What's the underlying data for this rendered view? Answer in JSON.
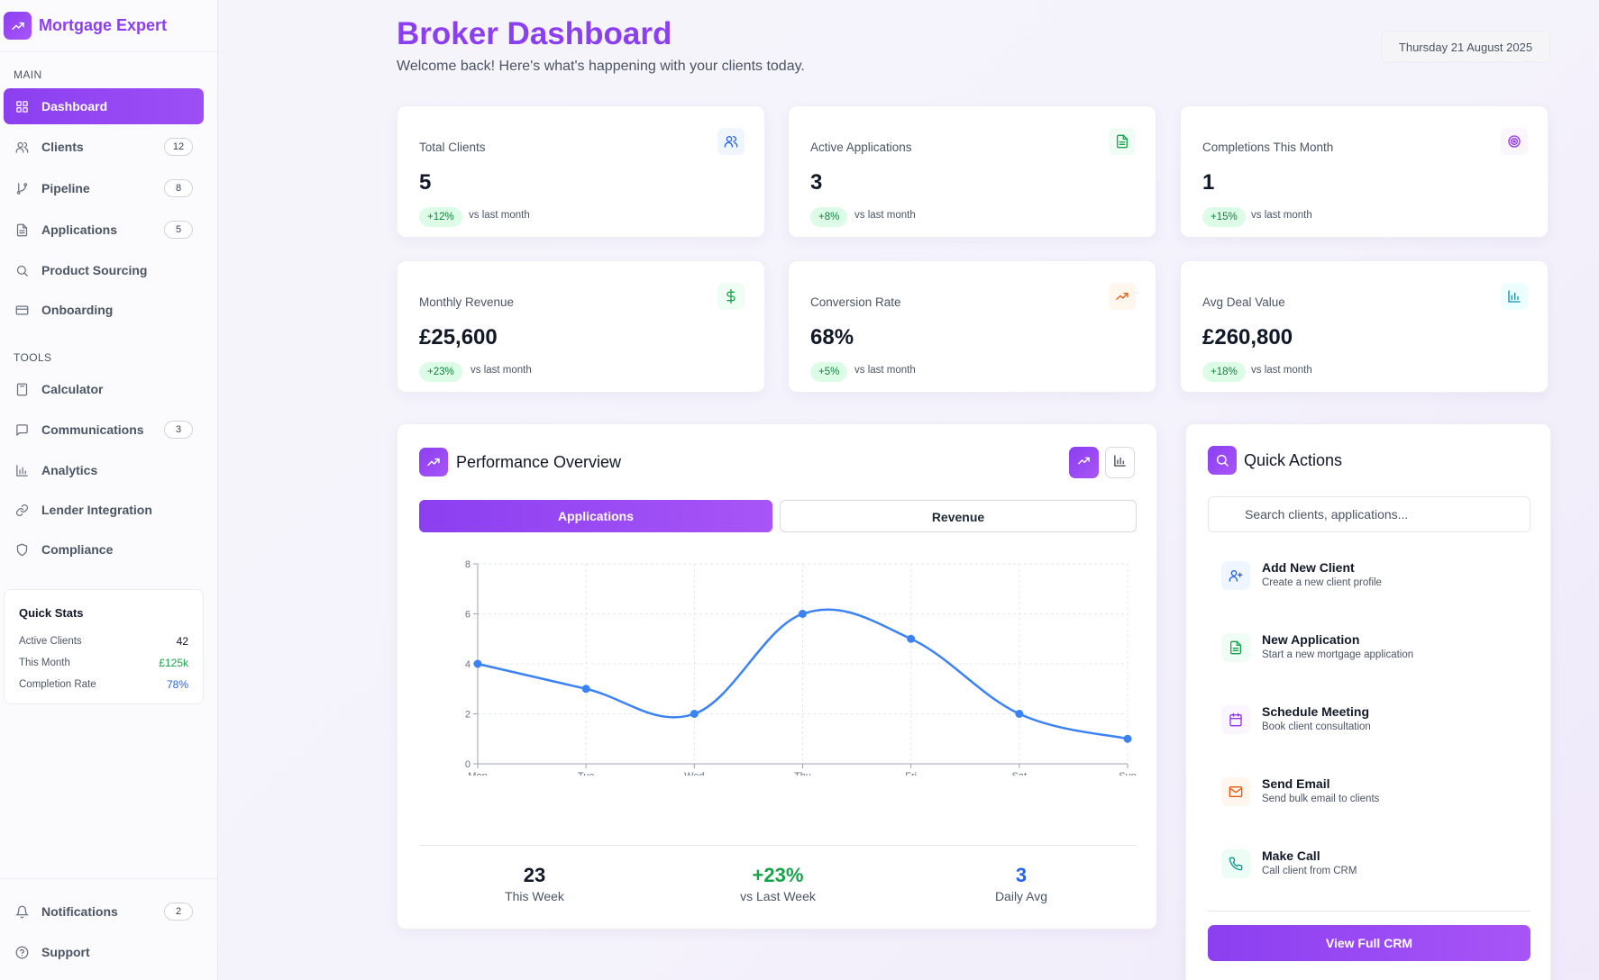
{
  "brand": {
    "name": "Mortgage Expert"
  },
  "colors": {
    "accent": "#8b3ff0",
    "accent_light": "#a855f7",
    "green": "#16a34a",
    "blue": "#2563eb",
    "line": "#3b82f6"
  },
  "sidebar": {
    "main_label": "MAIN",
    "tools_label": "TOOLS",
    "main_items": [
      {
        "label": "Dashboard",
        "icon": "grid-icon"
      },
      {
        "label": "Clients",
        "icon": "users-icon",
        "badge": "12"
      },
      {
        "label": "Pipeline",
        "icon": "git-branch-icon",
        "badge": "8"
      },
      {
        "label": "Applications",
        "icon": "file-text-icon",
        "badge": "5"
      },
      {
        "label": "Product Sourcing",
        "icon": "search-icon"
      },
      {
        "label": "Onboarding",
        "icon": "credit-card-icon"
      }
    ],
    "tools_items": [
      {
        "label": "Calculator",
        "icon": "calculator-icon"
      },
      {
        "label": "Communications",
        "icon": "message-icon",
        "badge": "3"
      },
      {
        "label": "Analytics",
        "icon": "bar-chart-icon"
      },
      {
        "label": "Lender Integration",
        "icon": "link-icon"
      },
      {
        "label": "Compliance",
        "icon": "shield-icon"
      }
    ],
    "quick_stats": {
      "title": "Quick Stats",
      "rows": [
        {
          "label": "Active Clients",
          "value": "42"
        },
        {
          "label": "This Month",
          "value": "£125k"
        },
        {
          "label": "Completion Rate",
          "value": "78%"
        }
      ]
    },
    "bottom_items": [
      {
        "label": "Notifications",
        "icon": "bell-icon",
        "badge": "2"
      },
      {
        "label": "Support",
        "icon": "help-circle-icon"
      }
    ]
  },
  "header": {
    "title": "Broker Dashboard",
    "subtitle": "Welcome back! Here's what's happening with your clients today.",
    "date": "Thursday 21 August 2025"
  },
  "stats": [
    {
      "label": "Total Clients",
      "value": "5",
      "change": "+12%",
      "vs": "vs last month",
      "icon": "users-icon"
    },
    {
      "label": "Active Applications",
      "value": "3",
      "change": "+8%",
      "vs": "vs last month",
      "icon": "file-text-icon"
    },
    {
      "label": "Completions This Month",
      "value": "1",
      "change": "+15%",
      "vs": "vs last month",
      "icon": "target-icon"
    },
    {
      "label": "Monthly Revenue",
      "value": "£25,600",
      "change": "+23%",
      "vs": "vs last month",
      "icon": "dollar-icon"
    },
    {
      "label": "Conversion Rate",
      "value": "68%",
      "change": "+5%",
      "vs": "vs last month",
      "icon": "trending-up-icon"
    },
    {
      "label": "Avg Deal Value",
      "value": "£260,800",
      "change": "+18%",
      "vs": "vs last month",
      "icon": "bar-chart-icon"
    }
  ],
  "performance": {
    "title": "Performance Overview",
    "tabs": [
      "Applications",
      "Revenue"
    ],
    "summary": [
      {
        "value": "23",
        "label": "This Week"
      },
      {
        "value": "+23%",
        "label": "vs Last Week"
      },
      {
        "value": "3",
        "label": "Daily Avg"
      }
    ]
  },
  "chart_data": {
    "type": "line",
    "categories": [
      "Mon",
      "Tue",
      "Wed",
      "Thu",
      "Fri",
      "Sat",
      "Sun"
    ],
    "values": [
      4,
      3,
      2,
      6,
      5,
      2,
      1
    ],
    "ylim": [
      0,
      8
    ],
    "yticks": [
      0,
      2,
      4,
      6,
      8
    ],
    "grid": true,
    "title": "",
    "xlabel": "",
    "ylabel": ""
  },
  "quick_actions": {
    "title": "Quick Actions",
    "search_placeholder": "Search clients, applications...",
    "items": [
      {
        "title": "Add New Client",
        "subtitle": "Create a new client profile",
        "icon": "user-plus-icon"
      },
      {
        "title": "New Application",
        "subtitle": "Start a new mortgage application",
        "icon": "file-text-icon"
      },
      {
        "title": "Schedule Meeting",
        "subtitle": "Book client consultation",
        "icon": "calendar-icon"
      },
      {
        "title": "Send Email",
        "subtitle": "Send bulk email to clients",
        "icon": "mail-icon"
      },
      {
        "title": "Make Call",
        "subtitle": "Call client from CRM",
        "icon": "phone-icon"
      }
    ],
    "button_label": "View Full CRM"
  }
}
